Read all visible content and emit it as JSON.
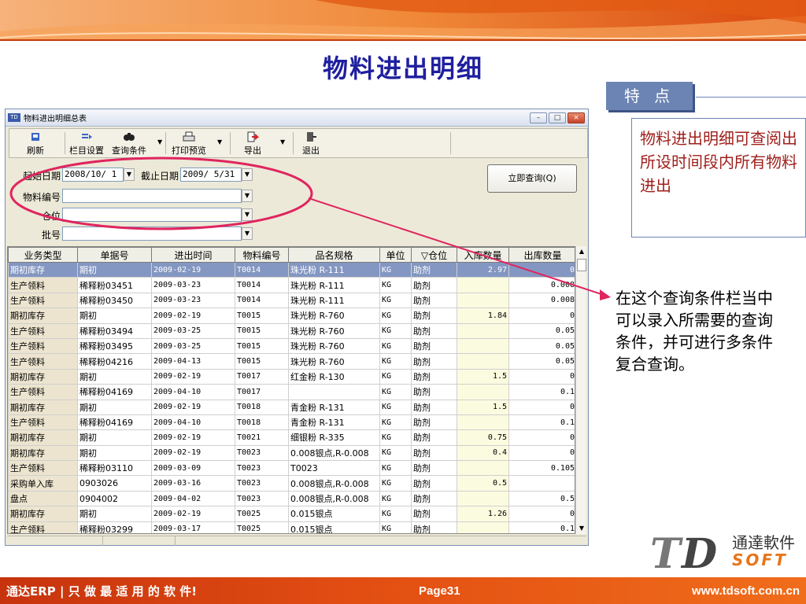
{
  "slide": {
    "title": "物料进出明细",
    "feature_tab": "特 点",
    "feature_text": "物料进出明细可查阅出所设时间段内所有物料进出",
    "note_text": "在这个查询条件栏当中可以录入所需要的查询条件，并可进行多条件复合查询。",
    "colors": {
      "title": "#1f1f9f",
      "feature_text": "#a0201c",
      "highlight_ellipse": "#e0245e",
      "footer": "#e24e12"
    }
  },
  "window": {
    "title": "物料进出明细总表",
    "controls": {
      "minimize": "–",
      "maximize": "□",
      "close": "×"
    },
    "toolbar": {
      "refresh": "刷新",
      "columns": "栏目设置",
      "query": "查询条件",
      "print": "打印预览",
      "export": "导出",
      "exit": "退出"
    },
    "query": {
      "start_label": "起始日期",
      "start_value": "2008/10/ 1",
      "end_label": "截止日期",
      "end_value": "2009/ 5/31",
      "material_label": "物料编号",
      "warehouse_label": "仓位",
      "batch_label": "批号",
      "run_button": "立即查询(Q)"
    },
    "grid": {
      "columns": [
        "业务类型",
        "单据号",
        "进出时间",
        "物料编号",
        "品名规格",
        "单位",
        "▽仓位",
        "入库数量",
        "出库数量"
      ],
      "rows": [
        [
          "期初库存",
          "期初",
          "2009-02-19",
          "T0014",
          "珠光粉  R-111",
          "KG",
          "助剂",
          "2.97",
          "0"
        ],
        [
          "生产领料",
          "稀释粉03451",
          "2009-03-23",
          "T0014",
          "珠光粉  R-111",
          "KG",
          "助剂",
          "",
          "0.008"
        ],
        [
          "生产领料",
          "稀释粉03450",
          "2009-03-23",
          "T0014",
          "珠光粉  R-111",
          "KG",
          "助剂",
          "",
          "0.008"
        ],
        [
          "期初库存",
          "期初",
          "2009-02-19",
          "T0015",
          "珠光粉  R-760",
          "KG",
          "助剂",
          "1.84",
          "0"
        ],
        [
          "生产领料",
          "稀释粉03494",
          "2009-03-25",
          "T0015",
          "珠光粉  R-760",
          "KG",
          "助剂",
          "",
          "0.05"
        ],
        [
          "生产领料",
          "稀释粉03495",
          "2009-03-25",
          "T0015",
          "珠光粉  R-760",
          "KG",
          "助剂",
          "",
          "0.05"
        ],
        [
          "生产领料",
          "稀释粉04216",
          "2009-04-13",
          "T0015",
          "珠光粉  R-760",
          "KG",
          "助剂",
          "",
          "0.05"
        ],
        [
          "期初库存",
          "期初",
          "2009-02-19",
          "T0017",
          "红金粉 R-130",
          "KG",
          "助剂",
          "1.5",
          "0"
        ],
        [
          "生产领料",
          "稀释粉04169",
          "2009-04-10",
          "T0017",
          "",
          "KG",
          "助剂",
          "",
          "0.1"
        ],
        [
          "期初库存",
          "期初",
          "2009-02-19",
          "T0018",
          "青金粉 R-131",
          "KG",
          "助剂",
          "1.5",
          "0"
        ],
        [
          "生产领料",
          "稀释粉04169",
          "2009-04-10",
          "T0018",
          "青金粉 R-131",
          "KG",
          "助剂",
          "",
          "0.1"
        ],
        [
          "期初库存",
          "期初",
          "2009-02-19",
          "T0021",
          "细银粉 R-335",
          "KG",
          "助剂",
          "0.75",
          "0"
        ],
        [
          "期初库存",
          "期初",
          "2009-02-19",
          "T0023",
          "0.008银点,R-0.008",
          "KG",
          "助剂",
          "0.4",
          "0"
        ],
        [
          "生产领料",
          "稀释粉03110",
          "2009-03-09",
          "T0023",
          "T0023",
          "KG",
          "助剂",
          "",
          "0.105"
        ],
        [
          "采购单入库",
          "0903026",
          "2009-03-16",
          "T0023",
          "0.008银点,R-0.008",
          "KG",
          "助剂",
          "0.5",
          ""
        ],
        [
          "盘点",
          "0904002",
          "2009-04-02",
          "T0023",
          "0.008银点,R-0.008",
          "KG",
          "助剂",
          "",
          "0.5"
        ],
        [
          "期初库存",
          "期初",
          "2009-02-19",
          "T0025",
          "0.015银点",
          "KG",
          "助剂",
          "1.26",
          "0"
        ],
        [
          "生产领料",
          "稀释粉03299",
          "2009-03-17",
          "T0025",
          "0.015银点",
          "KG",
          "助剂",
          "",
          "0.1"
        ]
      ]
    }
  },
  "logo": {
    "cn": "通達軟件",
    "soft": "SOFT"
  },
  "footer": {
    "left": "通达ERP | 只 做 最 适 用 的 软 件!",
    "page": "Page31",
    "url": "www.tdsoft.com.cn"
  }
}
